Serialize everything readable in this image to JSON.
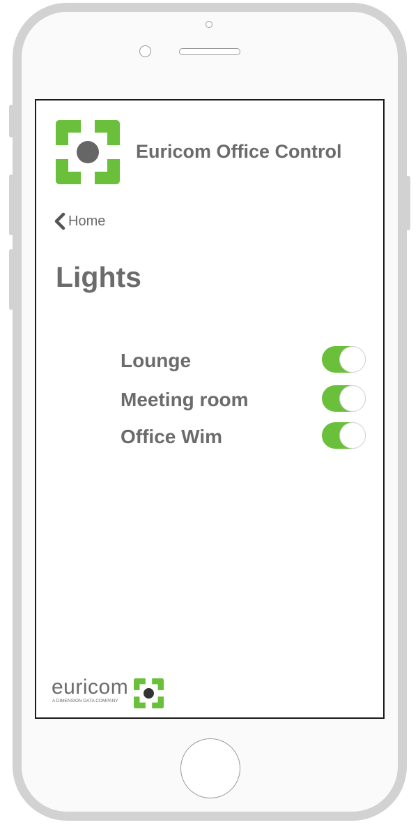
{
  "app": {
    "title": "Euricom Office Control",
    "logo_icon": "euricom-logo-icon",
    "accent_color": "#6abf3b",
    "text_color": "#6b6b6b"
  },
  "nav": {
    "back_label": "Home",
    "back_icon": "chevron-left-icon"
  },
  "page": {
    "title": "Lights"
  },
  "lights": [
    {
      "name": "Lounge",
      "on": true
    },
    {
      "name": "Meeting room",
      "on": true
    },
    {
      "name": "Office Wim",
      "on": true
    }
  ],
  "footer": {
    "brand": "euricom",
    "tagline": "A DIMENSION DATA COMPANY"
  }
}
